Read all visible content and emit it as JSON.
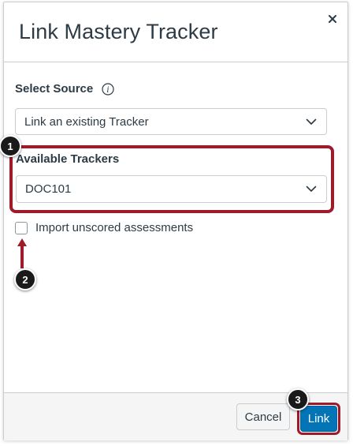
{
  "dialog": {
    "title": "Link Mastery Tracker",
    "close_icon": "close-icon"
  },
  "source": {
    "label": "Select Source",
    "info_icon": "info-icon",
    "selected": "Link an existing Tracker"
  },
  "trackers": {
    "label": "Available Trackers",
    "selected": "DOC101"
  },
  "import_checkbox": {
    "label": "Import unscored assessments",
    "checked": false
  },
  "footer": {
    "cancel_label": "Cancel",
    "link_label": "Link"
  },
  "callouts": {
    "step_1": "1",
    "step_2": "2",
    "step_3": "3"
  },
  "colors": {
    "primary": "#0374b5",
    "highlight": "#a01b2a",
    "text": "#2d3b45",
    "border": "#c7cdd1"
  }
}
